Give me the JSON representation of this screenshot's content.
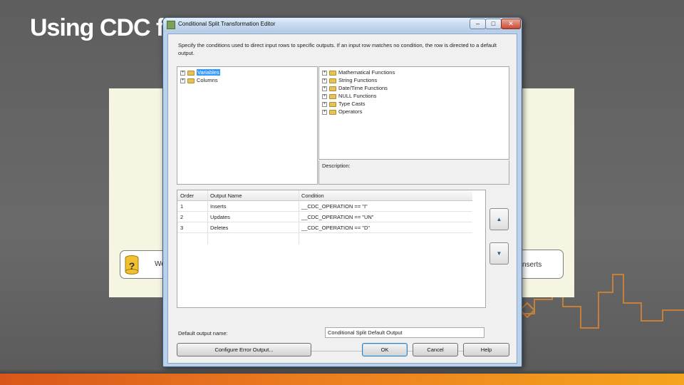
{
  "slide": {
    "title": "Using CDC fr"
  },
  "background_flow": {
    "left_box_text": "We",
    "right_box_text": "nserts",
    "db_icon_glyph": "?"
  },
  "dialog": {
    "title": "Conditional Split Transformation Editor",
    "title_buttons": {
      "min": "–",
      "max": "□",
      "close": "✕"
    },
    "intro": "Specify the conditions used to direct input rows to specific outputs. If an input row matches no condition, the row is directed to a default output.",
    "left_tree": [
      {
        "label": "Variables",
        "selected": true,
        "expander": "+"
      },
      {
        "label": "Columns",
        "selected": false,
        "expander": "+"
      }
    ],
    "right_tree": [
      {
        "label": "Mathematical Functions",
        "expander": "+"
      },
      {
        "label": "String Functions",
        "expander": "+"
      },
      {
        "label": "Date/Time Functions",
        "expander": "+"
      },
      {
        "label": "NULL Functions",
        "expander": "+"
      },
      {
        "label": "Type Casts",
        "expander": "+"
      },
      {
        "label": "Operators",
        "expander": "+"
      }
    ],
    "description_label": "Description:",
    "grid": {
      "headers": [
        "Order",
        "Output Name",
        "Condition"
      ],
      "rows": [
        [
          "1",
          "Inserts",
          "__CDC_OPERATION == \"I\""
        ],
        [
          "2",
          "Updates",
          "__CDC_OPERATION == \"UN\""
        ],
        [
          "3",
          "Deletes",
          "__CDC_OPERATION == \"D\""
        ]
      ]
    },
    "move_up_glyph": "▲",
    "move_down_glyph": "▼",
    "default_output_label": "Default output name:",
    "default_output_value": "Conditional Split Default Output",
    "buttons": {
      "configure_error": "Configure Error Output...",
      "ok": "OK",
      "cancel": "Cancel",
      "help": "Help"
    }
  },
  "colors": {
    "accent_orange": "#ec7d1f",
    "panel_cream": "#f6f5e2",
    "selection_blue": "#3399ff"
  }
}
